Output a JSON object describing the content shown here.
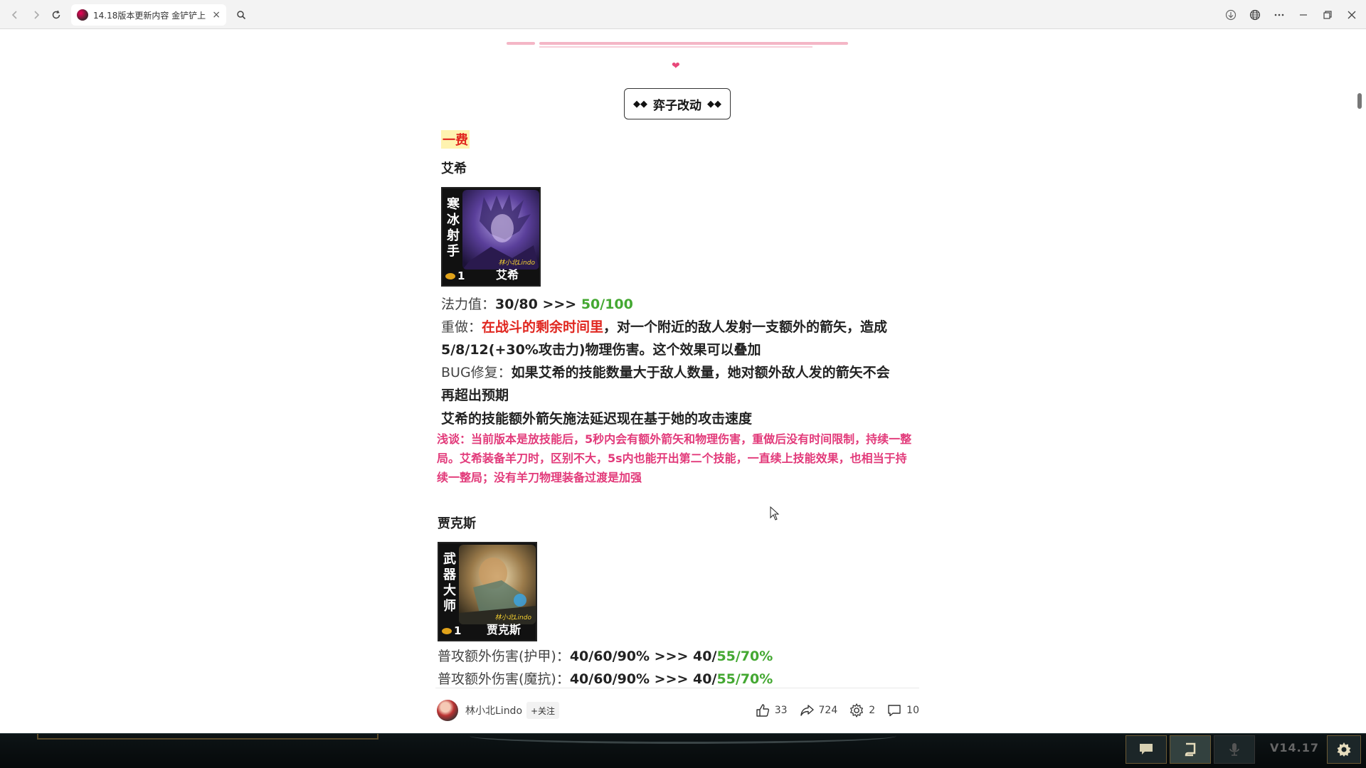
{
  "browser": {
    "tab_title": "14.18版本更新内容 金铲铲上",
    "tab_close": "×"
  },
  "article": {
    "section_title": "弈子改动",
    "tier": "一费",
    "champ1": {
      "name": "艾希",
      "card_title": [
        "寒",
        "冰",
        "射",
        "手"
      ],
      "cost": "1",
      "card_name": "艾希",
      "watermark": "林小北Lindo",
      "mana_label": "法力值：",
      "mana_old": "30/80 >>> ",
      "mana_new": "50/100",
      "rework_label": "重做：",
      "rework_red": "在战斗的剩余时间里",
      "rework_text1": "，对一个附近的敌人发射一支额外的箭矢，造成",
      "rework_text2": "5/8/12(+30%攻击力)物理伤害。这个效果可以叠加",
      "bugfix_label": "BUG修复：",
      "bugfix_text1": "如果艾希的技能数量大于敌人数量，她对额外敌人发的箭矢不会",
      "bugfix_text2": "再超出预期",
      "note": "艾希的技能额外箭矢施法延迟现在基于她的攻击速度",
      "comment": "浅谈：当前版本是放技能后，5秒内会有额外箭矢和物理伤害，重做后没有时间限制，持续一整局。艾希装备羊刀时，区别不大，5s内也能开出第二个技能，一直续上技能效果，也相当于持续一整局；没有羊刀物理装备过渡是加强"
    },
    "champ2": {
      "name": "贾克斯",
      "card_title": [
        "武",
        "器",
        "大",
        "师"
      ],
      "cost": "1",
      "card_name": "贾克斯",
      "watermark": "林小北Lindo",
      "stat1_label": "普攻额外伤害(护甲)：",
      "stat1_old": "40/60/90% >>> 40/",
      "stat1_new": "55/70%",
      "stat2_label": "普攻额外伤害(魔抗)：",
      "stat2_old": "40/60/90% >>> 40/",
      "stat2_new": "55/70%"
    }
  },
  "bottom_bar": {
    "author": "林小北Lindo",
    "follow": "+关注",
    "likes": "33",
    "shares": "724",
    "gifts": "2",
    "comments": "10"
  },
  "game": {
    "version": "V14.17"
  }
}
